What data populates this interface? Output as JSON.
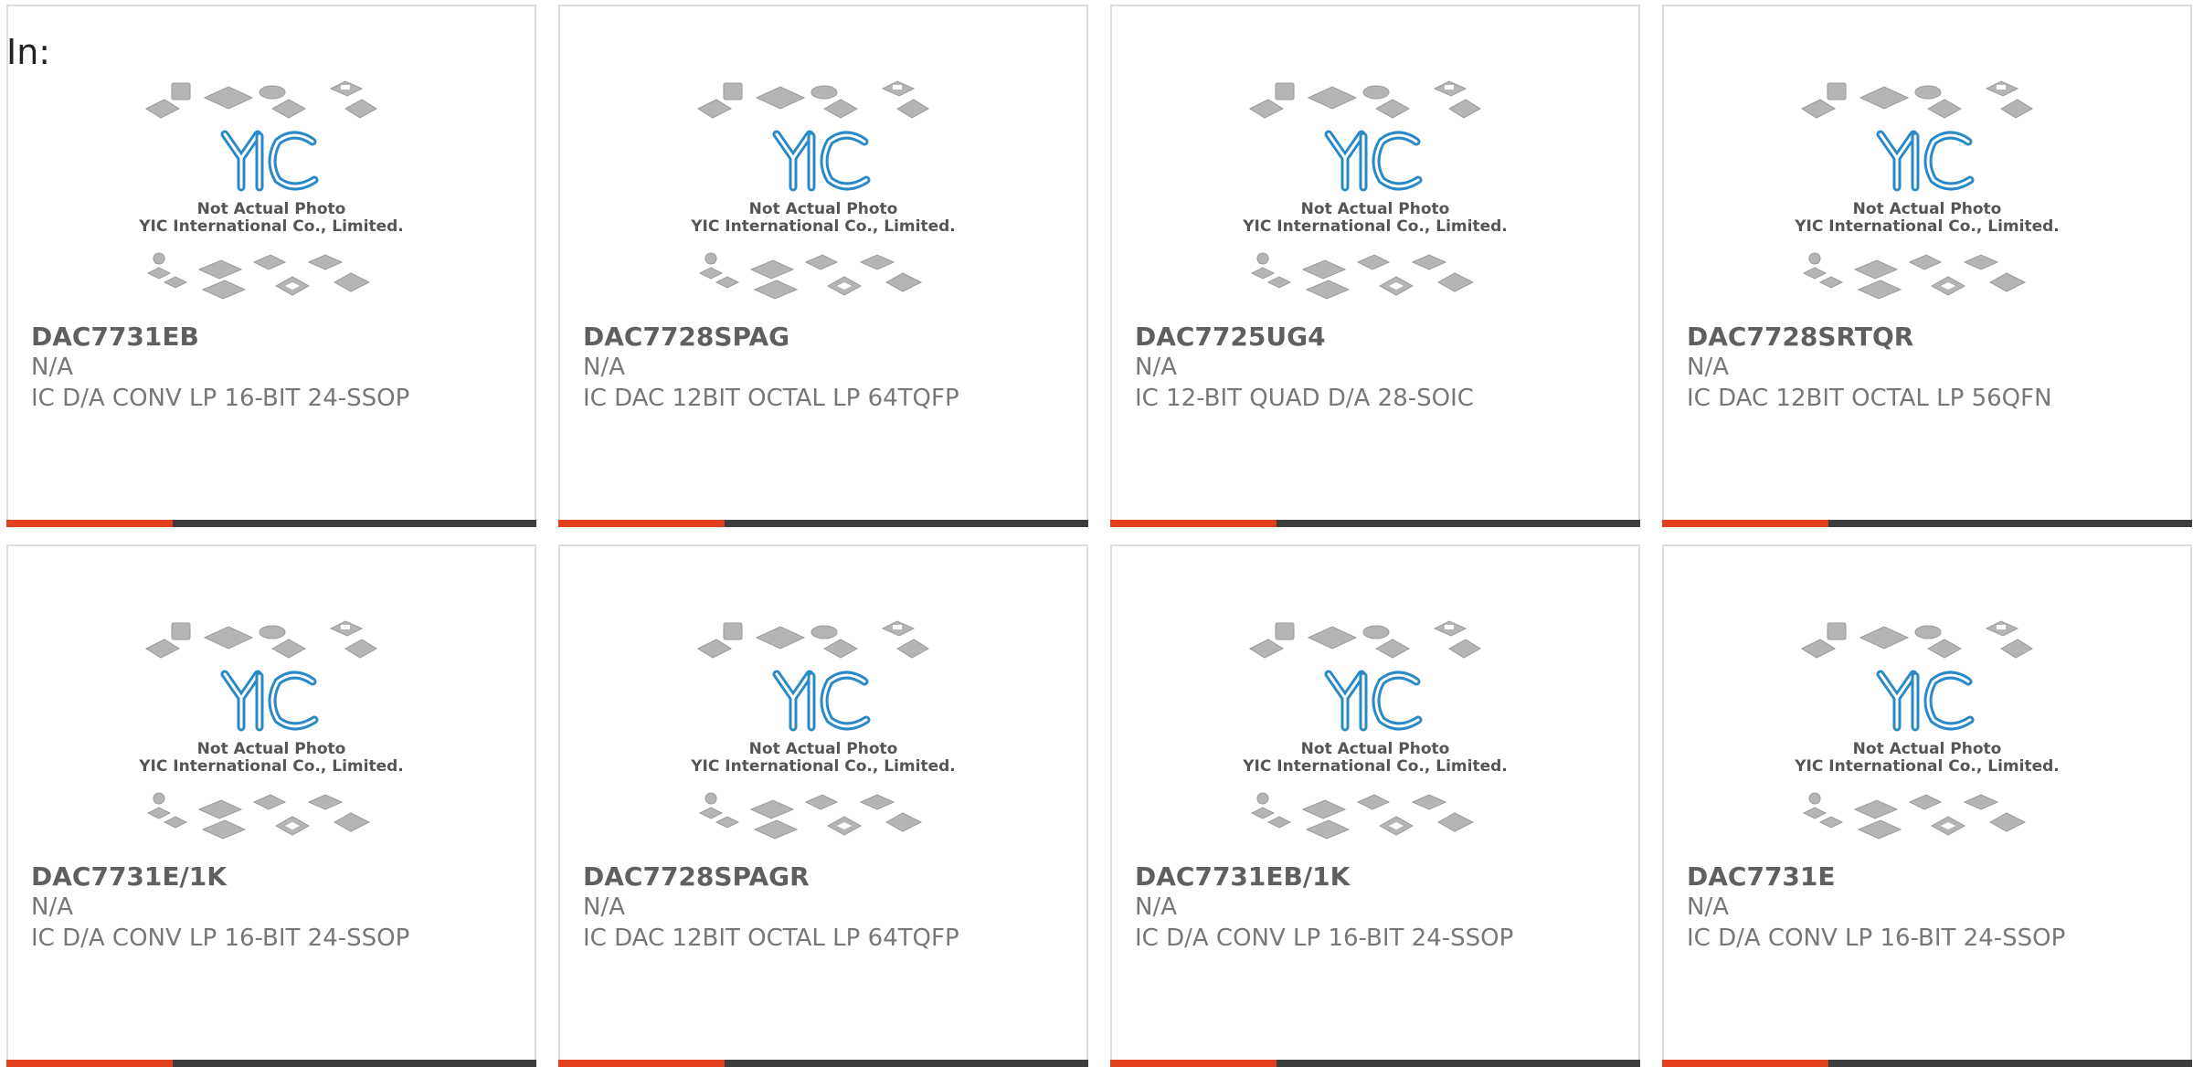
{
  "header": {
    "label": "In:"
  },
  "photo": {
    "icon": "chip-placeholder-icon",
    "logo_text": "YIC",
    "caption_line1": "Not Actual Photo",
    "caption_line2": "YIC International Co., Limited."
  },
  "colors": {
    "accent": "#e2401c",
    "bar": "#3d3d3d",
    "logo": "#2a8ac8",
    "text": "#777777"
  },
  "products": [
    {
      "part_number": "DAC7731EB",
      "manufacturer": "N/A",
      "description": "IC D/A CONV LP 16-BIT 24-SSOP"
    },
    {
      "part_number": "DAC7728SPAG",
      "manufacturer": "N/A",
      "description": "IC DAC 12BIT OCTAL LP 64TQFP"
    },
    {
      "part_number": "DAC7725UG4",
      "manufacturer": "N/A",
      "description": "IC 12-BIT QUAD D/A 28-SOIC"
    },
    {
      "part_number": "DAC7728SRTQR",
      "manufacturer": "N/A",
      "description": "IC DAC 12BIT OCTAL LP 56QFN"
    },
    {
      "part_number": "DAC7731E/1K",
      "manufacturer": "N/A",
      "description": "IC D/A CONV LP 16-BIT 24-SSOP"
    },
    {
      "part_number": "DAC7728SPAGR",
      "manufacturer": "N/A",
      "description": "IC DAC 12BIT OCTAL LP 64TQFP"
    },
    {
      "part_number": "DAC7731EB/1K",
      "manufacturer": "N/A",
      "description": "IC D/A CONV LP 16-BIT 24-SSOP"
    },
    {
      "part_number": "DAC7731E",
      "manufacturer": "N/A",
      "description": "IC D/A CONV LP 16-BIT 24-SSOP"
    }
  ]
}
